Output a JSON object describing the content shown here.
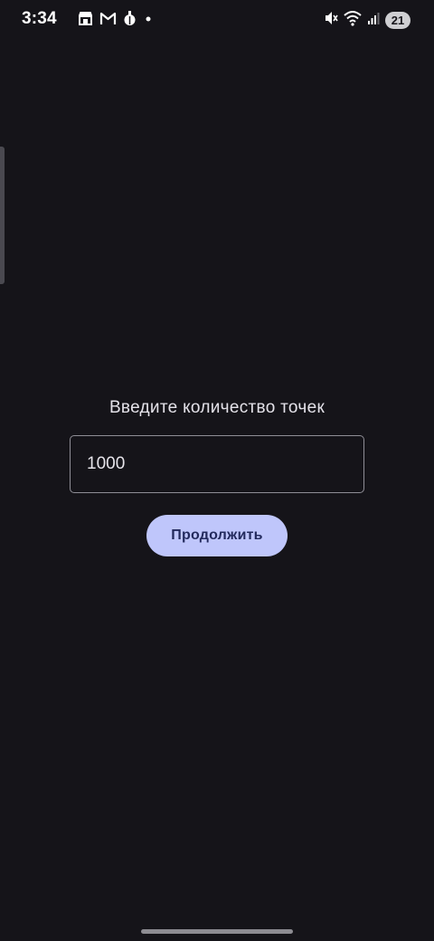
{
  "status_bar": {
    "time": "3:34",
    "battery_level": "21",
    "left_icons": [
      "store-icon",
      "gmail-icon",
      "bug-app-icon",
      "notification-dot-icon"
    ],
    "right_icons": [
      "mute-icon",
      "wifi-icon",
      "signal-icon",
      "battery-icon"
    ]
  },
  "main": {
    "prompt": "Введите количество точек",
    "points_input_value": "1000",
    "continue_label": "Продолжить"
  },
  "colors": {
    "background": "#151419",
    "button_bg": "#bfc6fb",
    "button_text": "#232a5d",
    "input_border": "#8f8e96"
  }
}
